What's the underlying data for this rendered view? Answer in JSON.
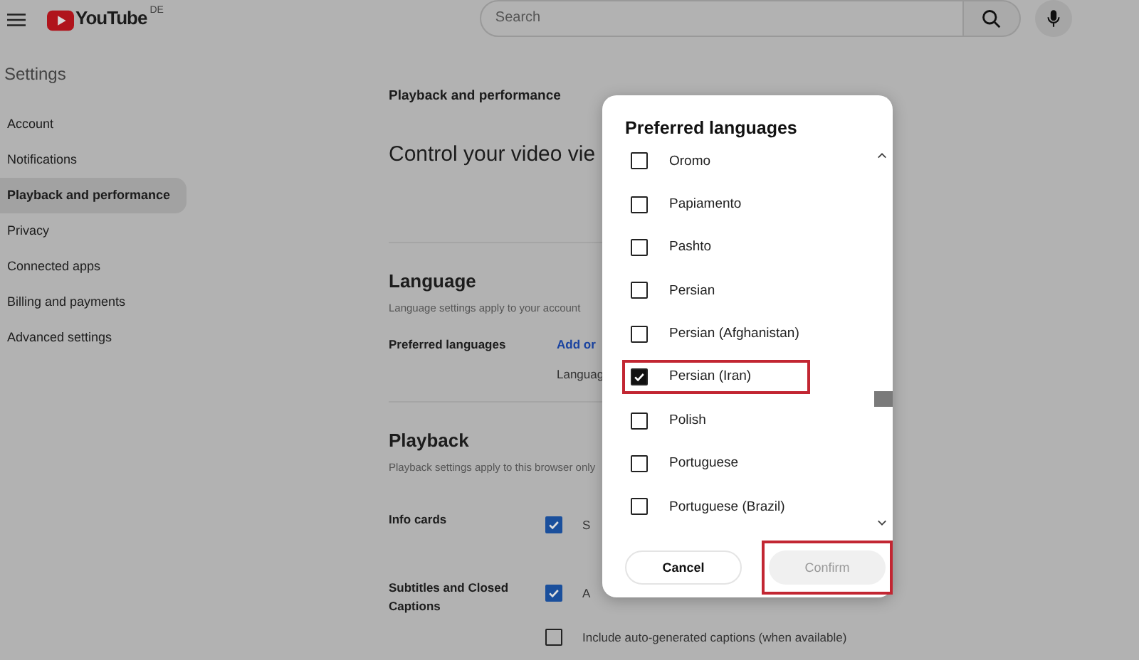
{
  "header": {
    "logo_text": "YouTube",
    "region": "DE",
    "search": {
      "placeholder": "Search"
    }
  },
  "sidebar": {
    "title": "Settings",
    "items": [
      {
        "label": "Account",
        "selected": false
      },
      {
        "label": "Notifications",
        "selected": false
      },
      {
        "label": "Playback and performance",
        "selected": true
      },
      {
        "label": "Privacy",
        "selected": false
      },
      {
        "label": "Connected apps",
        "selected": false
      },
      {
        "label": "Billing and payments",
        "selected": false
      },
      {
        "label": "Advanced settings",
        "selected": false
      }
    ]
  },
  "main": {
    "section_label": "Playback and performance",
    "heading": "Control your video vie",
    "language": {
      "title": "Language",
      "description": "Language settings apply to your account",
      "row_label": "Preferred languages",
      "link": "Add or",
      "value": "Languag"
    },
    "playback": {
      "title": "Playback",
      "description": "Playback settings apply to this browser only",
      "rows": [
        {
          "label": "Info cards",
          "options": [
            {
              "label": "S",
              "checked": true
            }
          ]
        },
        {
          "label": "Subtitles and Closed Captions",
          "options": [
            {
              "label": "A",
              "checked": true
            },
            {
              "label": "Include auto-generated captions (when available)",
              "checked": false
            }
          ]
        }
      ]
    }
  },
  "dialog": {
    "title": "Preferred languages",
    "languages": [
      {
        "label": "Oromo",
        "checked": false,
        "highlighted": false
      },
      {
        "label": "Papiamento",
        "checked": false,
        "highlighted": false
      },
      {
        "label": "Pashto",
        "checked": false,
        "highlighted": false
      },
      {
        "label": "Persian",
        "checked": false,
        "highlighted": false
      },
      {
        "label": "Persian (Afghanistan)",
        "checked": false,
        "highlighted": false
      },
      {
        "label": "Persian (Iran)",
        "checked": true,
        "highlighted": true
      },
      {
        "label": "Polish",
        "checked": false,
        "highlighted": false
      },
      {
        "label": "Portuguese",
        "checked": false,
        "highlighted": false
      },
      {
        "label": "Portuguese (Brazil)",
        "checked": false,
        "highlighted": false
      }
    ],
    "buttons": [
      {
        "label": "Cancel",
        "kind": "cancel",
        "disabled": false,
        "highlighted": false
      },
      {
        "label": "Confirm",
        "kind": "confirm",
        "disabled": true,
        "highlighted": true
      }
    ]
  }
}
